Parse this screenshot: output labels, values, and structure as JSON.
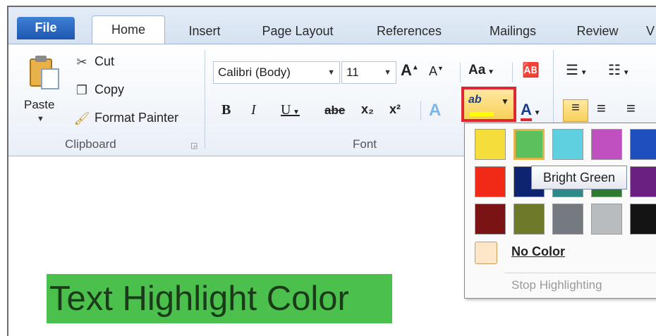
{
  "tabs": {
    "file": "File",
    "home": "Home",
    "insert": "Insert",
    "page_layout": "Page Layout",
    "references": "References",
    "mailings": "Mailings",
    "review": "Review",
    "more": "V"
  },
  "clipboard": {
    "paste": "Paste",
    "cut": "Cut",
    "copy": "Copy",
    "format_painter": "Format Painter",
    "group_label": "Clipboard"
  },
  "font": {
    "font_name": "Calibri (Body)",
    "font_size": "11",
    "group_label": "Font",
    "bold": "B",
    "italic": "I",
    "underline": "U",
    "strikethrough": "abe",
    "subscript": "x₂",
    "superscript": "x²",
    "grow": "A",
    "shrink": "A",
    "change_case": "Aa",
    "font_color_glyph": "A",
    "highlight_glyph": "ab"
  },
  "palette": {
    "colors": [
      "#f5dd3c",
      "#5cc05c",
      "#5fd0e0",
      "#c04fc0",
      "#1f4fbf",
      "#f02a16",
      "#0f2470",
      "#2c8a8a",
      "#2e7a2e",
      "#6a2080",
      "#7a1414",
      "#6e7a2a",
      "#747a80",
      "#b8bcbe",
      "#141414"
    ],
    "selected_index": 1,
    "tooltip": "Bright Green",
    "no_color": "No Color",
    "stop_highlighting": "Stop Highlighting"
  },
  "document": {
    "text": "Text Highlight Color",
    "highlight_color": "#4cc04c"
  },
  "colors": {
    "accent_red": "#e0262e",
    "file_tab": "#2b6ac7"
  }
}
